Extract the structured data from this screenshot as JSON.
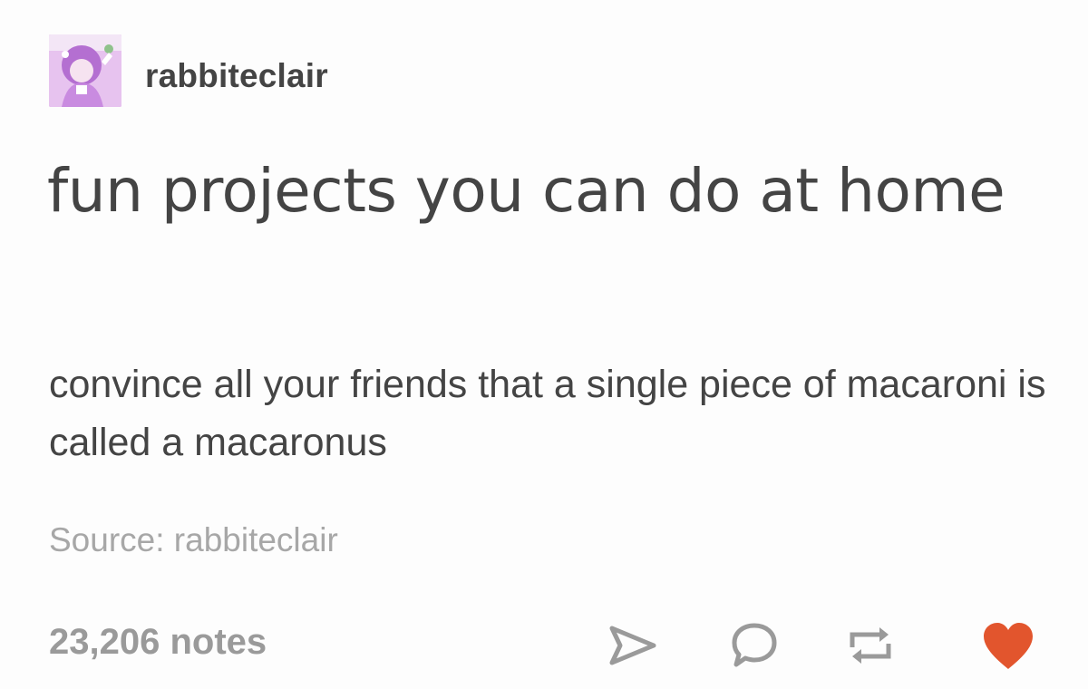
{
  "post": {
    "username": "rabbiteclair",
    "title": "fun projects you can do at home",
    "body": "convince all your friends that a single piece of macaroni is called a macaronus",
    "source_prefix": "Source:",
    "source_name": "rabbiteclair",
    "notes": "23,206 notes"
  },
  "footer": {
    "icons": [
      "share-icon",
      "reply-icon",
      "reblog-icon",
      "heart-icon"
    ]
  },
  "colors": {
    "text": "#444444",
    "muted": "#a7a7a7",
    "icon": "#9a9a9a",
    "like": "#e2552d",
    "avatar": "#d9a3e6"
  }
}
